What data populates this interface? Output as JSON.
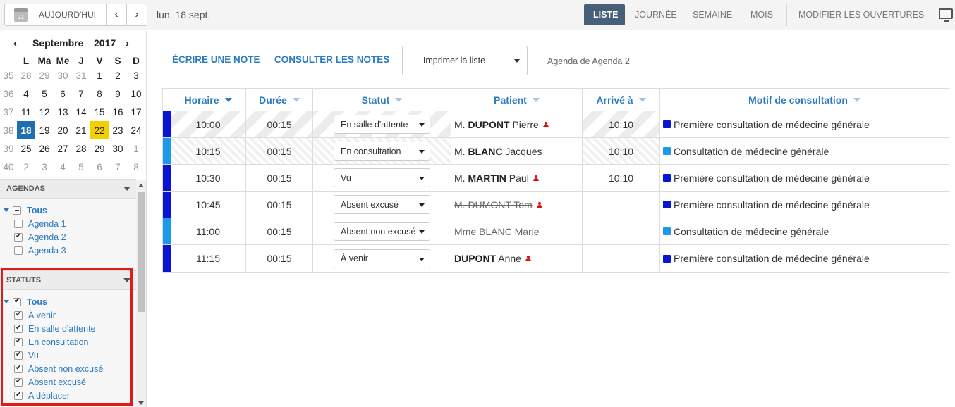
{
  "toolbar": {
    "today_icon_day": "22",
    "today_label": "AUJOURD'HUI",
    "prev_glyph": "‹",
    "next_glyph": "›",
    "current_date": "lun. 18 sept.",
    "views": {
      "liste": "LISTE",
      "journee": "JOURNÉE",
      "semaine": "SEMAINE",
      "mois": "MOIS",
      "ouvertures": "MODIFIER LES OUVERTURES"
    }
  },
  "mini_calendar": {
    "prev_glyph": "‹",
    "next_glyph": "›",
    "month": "Septembre",
    "year": "2017",
    "dow": [
      "L",
      "Ma",
      "Me",
      "J",
      "V",
      "S",
      "D"
    ],
    "weeks": [
      {
        "num": "35",
        "days": [
          "28",
          "29",
          "30",
          "31",
          "1",
          "2",
          "3"
        ]
      },
      {
        "num": "36",
        "days": [
          "4",
          "5",
          "6",
          "7",
          "8",
          "9",
          "10"
        ]
      },
      {
        "num": "37",
        "days": [
          "11",
          "12",
          "13",
          "14",
          "15",
          "16",
          "17"
        ]
      },
      {
        "num": "38",
        "days": [
          "18",
          "19",
          "20",
          "21",
          "22",
          "23",
          "24"
        ]
      },
      {
        "num": "39",
        "days": [
          "25",
          "26",
          "27",
          "28",
          "29",
          "30",
          "1"
        ]
      },
      {
        "num": "40",
        "days": [
          "2",
          "3",
          "4",
          "5",
          "6",
          "7",
          "8"
        ]
      }
    ],
    "selected_color": "#1f6fb0",
    "today_color": "#f5d000"
  },
  "agendas": {
    "header": "AGENDAS",
    "root_label": "Tous",
    "items": [
      {
        "label": "Agenda 1",
        "checked": false
      },
      {
        "label": "Agenda 2",
        "checked": true
      },
      {
        "label": "Agenda 3",
        "checked": false
      }
    ]
  },
  "statuts": {
    "header": "STATUTS",
    "root_label": "Tous",
    "items": [
      {
        "label": "À venir",
        "checked": true
      },
      {
        "label": "En salle d'attente",
        "checked": true
      },
      {
        "label": "En consultation",
        "checked": true
      },
      {
        "label": "Vu",
        "checked": true
      },
      {
        "label": "Absent non excusé",
        "checked": true
      },
      {
        "label": "Absent excusé",
        "checked": true
      },
      {
        "label": "A déplacer",
        "checked": true
      }
    ]
  },
  "main": {
    "write_note": "ÉCRIRE UNE NOTE",
    "view_notes": "CONSULTER LES NOTES",
    "print_label": "Imprimer la liste",
    "agenda_caption": "Agenda de Agenda 2"
  },
  "table": {
    "headers": {
      "horaire": "Horaire",
      "duree": "Durée",
      "statut": "Statut",
      "patient": "Patient",
      "arrive": "Arrivé à",
      "motif": "Motif de consultation"
    },
    "colors": {
      "premiere": "#0a14d6",
      "consultation": "#1e98e8",
      "accent": "#2a7bc0"
    },
    "rows": [
      {
        "horaire": "10:00",
        "duree": "00:15",
        "statut": "En salle d'attente",
        "civ": "M.",
        "nom": "DUPONT",
        "prenom": "Pierre",
        "arrive": "10:10",
        "motif": "Première consultation de médecine générale"
      },
      {
        "horaire": "10:15",
        "duree": "00:15",
        "statut": "En consultation",
        "civ": "M.",
        "nom": "BLANC",
        "prenom": "Jacques",
        "arrive": "10:10",
        "motif": "Consultation de médecine générale"
      },
      {
        "horaire": "10:30",
        "duree": "00:15",
        "statut": "Vu",
        "civ": "M.",
        "nom": "MARTIN",
        "prenom": "Paul",
        "arrive": "10:10",
        "motif": "Première consultation de médecine générale"
      },
      {
        "horaire": "10:45",
        "duree": "00:15",
        "statut": "Absent excusé",
        "patient_full": "M. DUMONT Tom",
        "arrive": "",
        "motif": "Première consultation de médecine générale"
      },
      {
        "horaire": "11:00",
        "duree": "00:15",
        "statut": "Absent non excusé",
        "patient_full": "Mme BLANC Marie",
        "arrive": "",
        "motif": "Consultation de médecine générale"
      },
      {
        "horaire": "11:15",
        "duree": "00:15",
        "statut": "À venir",
        "civ": "",
        "nom": "DUPONT",
        "prenom": "Anne",
        "arrive": "",
        "motif": "Première consultation de médecine générale"
      }
    ]
  }
}
